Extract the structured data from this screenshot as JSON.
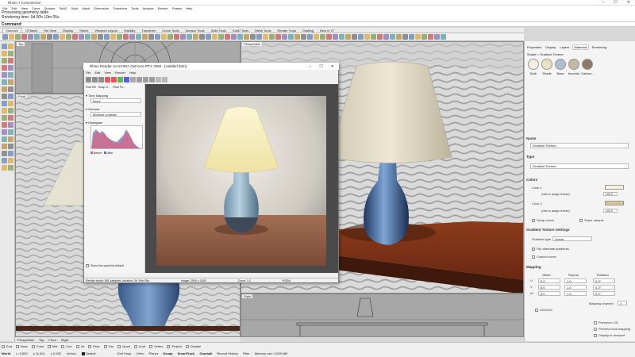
{
  "window": {
    "title": "Rhino 7 Commercial"
  },
  "menu": [
    "File",
    "Edit",
    "View",
    "Curve",
    "Surface",
    "SubD",
    "Solid",
    "Mesh",
    "Dimension",
    "Transform",
    "Tools",
    "Analyze",
    "Render",
    "Panels",
    "Help"
  ],
  "command_history": [
    "Processing geometry table",
    "Rendering time: 0d 00h 10m 05s"
  ],
  "command_prompt": "Command:",
  "toolbar_tabs": [
    "Standard",
    "CPlanes",
    "Set View",
    "Display",
    "Select",
    "Viewport Layout",
    "Visibility",
    "Transform",
    "Curve Tools",
    "Surface Tools",
    "Solid Tools",
    "SubD Tools",
    "Mesh Tools",
    "Render Tools",
    "Drafting",
    "New in V7"
  ],
  "toolbar_active": "Standard",
  "viewports": {
    "top": "Top",
    "front": "Front",
    "perspective": "Perspective",
    "right": "Right"
  },
  "viewport_tabs": [
    "Perspective",
    "Top",
    "Front",
    "Right"
  ],
  "panel": {
    "tabs": [
      "Properties",
      "Display",
      "Layers",
      "Materials",
      "Rendering"
    ],
    "breadcrumb": "Shade > Gradient Texture",
    "swatches": [
      {
        "label": "Bulb",
        "color": "#f3f0df"
      },
      {
        "label": "Shade",
        "color": "#e8e1c4"
      },
      {
        "label": "Base",
        "color": "#aebdcf"
      },
      {
        "label": "Accento",
        "color": "#c4b8a3"
      },
      {
        "label": "Carbon...",
        "color": "#8c7966"
      }
    ],
    "name_section": "Name",
    "name_value": "Gradient Texture",
    "type_section": "Type",
    "type_value": "Gradient Texture",
    "colors_section": "Colors",
    "color1_label": "Color 1",
    "color2_label": "Color 2",
    "assign_texture": "(click to assign texture)",
    "amount_value": "100.0",
    "color1_swatch": "#f5f0e0",
    "color2_swatch": "#d6c68b",
    "swap_colors": "Swap colors",
    "super_sample": "Super sample",
    "gradient_settings_section": "Gradient Texture Settings",
    "gradient_type_label": "Gradient type",
    "gradient_type_value": "Linear",
    "flip_alternate": "Flip alternate gradients",
    "custom_curve": "Custom curve",
    "mapping_section": "Mapping",
    "mapping_headers": [
      "Offset",
      "Repeat",
      "Rotation"
    ],
    "mapping_rows": [
      {
        "axis": "U",
        "offset": "0.0",
        "repeat": "1.0",
        "rotation": "0.0°"
      },
      {
        "axis": "V",
        "offset": "0.0",
        "repeat": "1.0",
        "rotation": "0.0°"
      },
      {
        "axis": "W",
        "offset": "0.0",
        "repeat": "1.0",
        "rotation": "0.0°"
      }
    ],
    "mapping_channel_label": "Mapping channel:",
    "mapping_channel_value": "1",
    "wrap_label": "UV/U/UV",
    "preview_2d": "Preview in 2D",
    "preview_local": "Preview local mapping",
    "display_viewport": "Display in viewport"
  },
  "render_window": {
    "title": "Rhino Render on NVIDIA GeForce RTX 2080 - [Untitled.3dm]",
    "menu": [
      "File",
      "Edit",
      "View",
      "Render",
      "Help"
    ],
    "side_tabs": [
      "Post Eff",
      "Snap Vi...",
      "Final Po..."
    ],
    "tone_mapping_label": "Tone Mapping",
    "tone_mapping_value": "None",
    "gamma_label": "Gamma",
    "gamma_value": "Medium contrast",
    "histogram_label": "Histogram",
    "histogram_legend": [
      "Before",
      "After"
    ],
    "show_panel_default": "Show this panel by default",
    "status_left": "Render mode: 861 samples, duration: 0h 10m 05s",
    "status_mid": "Image: 2000 x 2000",
    "status_zoom": "Zoom: 1:2",
    "status_right": "RGBA"
  },
  "osnaps": [
    "End",
    "Near",
    "Point",
    "Mid",
    "Cen",
    "Int",
    "Perp",
    "Tan",
    "Quad",
    "Knot",
    "Vertex",
    "Project",
    "Disable"
  ],
  "statusbar": {
    "cplane": "World",
    "x": "x -5.800",
    "y": "y 11.601",
    "z": "z 0.000",
    "units": "Inches",
    "layer": "Default",
    "items": [
      "Grid Snap",
      "Ortho",
      "Planar",
      "Osnap",
      "SmartTrack",
      "Gumball",
      "Record History",
      "Filter",
      "Memory use: 2,009 MB"
    ]
  }
}
